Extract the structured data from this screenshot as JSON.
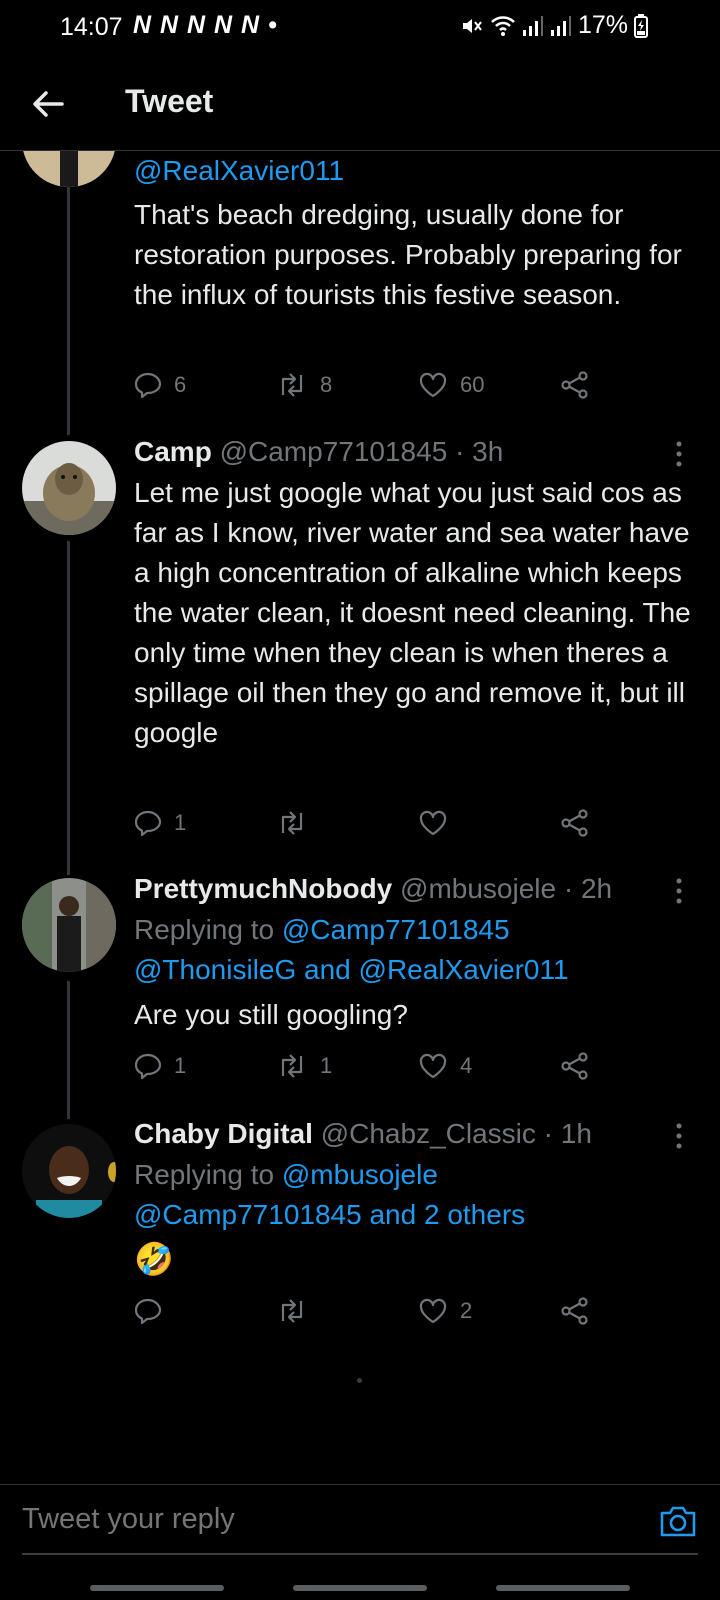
{
  "status_bar": {
    "time": "14:07",
    "notification_icons": "N N N N N •",
    "battery": "17%"
  },
  "header": {
    "title": "Tweet"
  },
  "tweets": [
    {
      "reply_to_handle": "@RealXavier011",
      "text": "That's beach dredging, usually done for restoration purposes. Probably preparing for the influx of tourists this festive season.",
      "replies": "6",
      "retweets": "8",
      "likes": "60"
    },
    {
      "name": "Camp",
      "handle": "@Camp77101845",
      "time": "· 3h",
      "text": "Let me just google what you just said cos as far as I know, river water and sea water have a high concentration of alkaline which keeps the water clean, it doesnt need cleaning. The only time when they clean is when theres a spillage oil then they go and remove it, but ill google",
      "replies": "1",
      "retweets": "",
      "likes": ""
    },
    {
      "name": "PrettymuchNobody",
      "handle": "@mbusojele",
      "time": "· 2h",
      "replying_prefix": "Replying to",
      "replying_line1": "@Camp77101845",
      "replying_line2": "@ThonisileG and @RealXavier011",
      "text": "Are you still googling?",
      "replies": "1",
      "retweets": "1",
      "likes": "4"
    },
    {
      "name": "Chaby Digital",
      "handle": "@Chabz_Classic",
      "time": "· 1h",
      "replying_prefix": "Replying to",
      "replying_line1": "@mbusojele",
      "replying_line2": "@Camp77101845 and 2 others",
      "text": "🤣",
      "replies": "",
      "retweets": "",
      "likes": "2"
    }
  ],
  "reply_bar": {
    "placeholder": "Tweet your reply"
  },
  "colors": {
    "background": "#000000",
    "link": "#1d9bf0",
    "muted": "#71767b",
    "text": "#e7e9ea"
  }
}
